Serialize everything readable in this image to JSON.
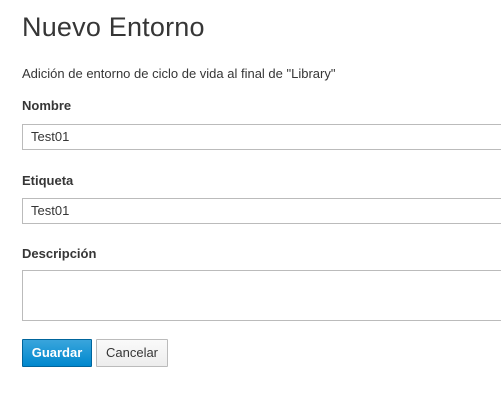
{
  "form": {
    "title": "Nuevo Entorno",
    "description": "Adición de entorno de ciclo de vida al final de \"Library\"",
    "fields": {
      "name": {
        "label": "Nombre",
        "value": "Test01"
      },
      "label": {
        "label": "Etiqueta",
        "value": "Test01"
      },
      "description": {
        "label": "Descripción",
        "value": ""
      }
    },
    "buttons": {
      "save": "Guardar",
      "cancel": "Cancelar"
    }
  },
  "colors": {
    "primary": "#0088ce",
    "text": "#363636",
    "border": "#bbbbbb"
  }
}
